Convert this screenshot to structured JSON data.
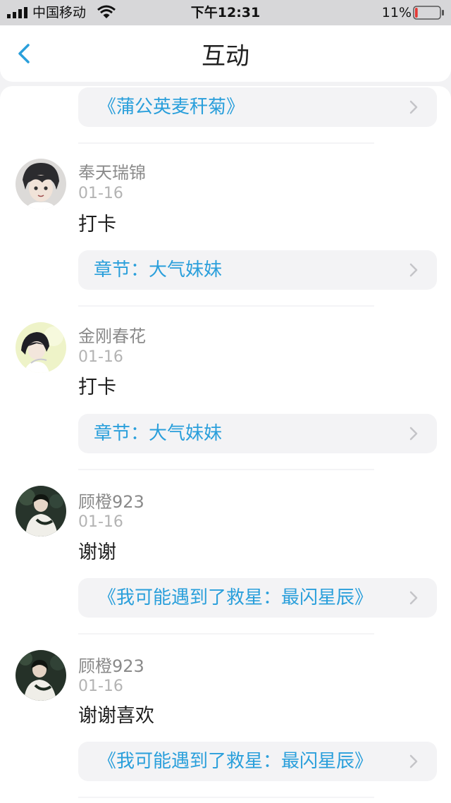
{
  "status_bar": {
    "carrier": "中国移动",
    "time": "下午12:31",
    "battery": "11%",
    "battery_color": "#e53935",
    "icons": [
      "signal-icon",
      "wifi-icon",
      "battery-icon"
    ]
  },
  "nav": {
    "title": "互动",
    "back_icon": "chevron-left-icon",
    "accent_color": "#2a9fdb"
  },
  "top_card": {
    "label": "《蒲公英麦秆菊》"
  },
  "items": [
    {
      "user": "奉天瑞锦",
      "date": "01-16",
      "comment": "打卡",
      "link": "章节：大气妹妹"
    },
    {
      "user": "金刚春花",
      "date": "01-16",
      "comment": "打卡",
      "link": "章节：大气妹妹"
    },
    {
      "user": "顾橙923",
      "date": "01-16",
      "comment": "谢谢",
      "link": "《我可能遇到了救星：最闪星辰》"
    },
    {
      "user": "顾橙923",
      "date": "01-16",
      "comment": "谢谢喜欢",
      "link": "《我可能遇到了救星：最闪星辰》"
    }
  ]
}
